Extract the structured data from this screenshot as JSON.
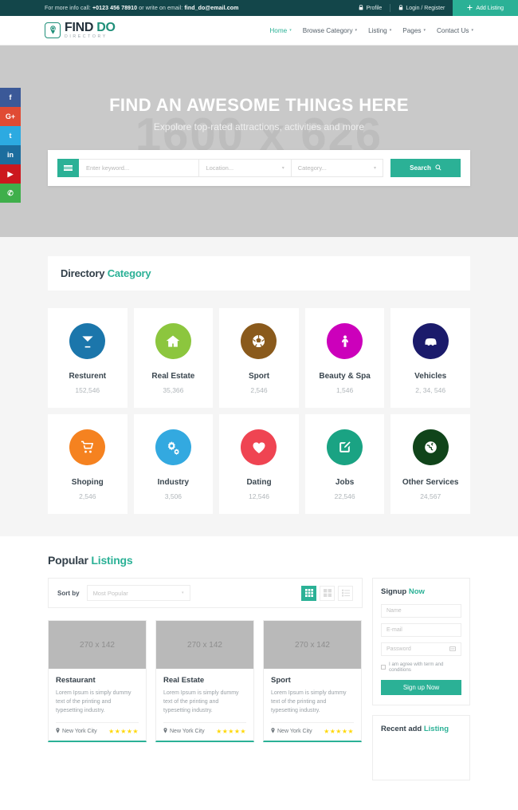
{
  "topbar": {
    "info_prefix": "For more info call:",
    "phone": "+0123 456 78910",
    "info_middle": "or write on email:",
    "email": "find_do@email.com",
    "profile_label": "Profile",
    "login_label": "Login / Register",
    "add_listing_label": "Add Listing",
    "bg_color": "#13464a",
    "accent_color": "#2bb196"
  },
  "nav": {
    "logo_main": "FIND ",
    "logo_accent": "DO",
    "logo_sub": "DIRECTORY",
    "items": [
      {
        "label": "Home",
        "active": true
      },
      {
        "label": "Browse Category",
        "active": false
      },
      {
        "label": "Listing",
        "active": false
      },
      {
        "label": "Pages",
        "active": false
      },
      {
        "label": "Contact Us",
        "active": false
      }
    ]
  },
  "social": [
    {
      "name": "facebook",
      "glyph": "f"
    },
    {
      "name": "google-plus",
      "glyph": "G+"
    },
    {
      "name": "twitter",
      "glyph": "t"
    },
    {
      "name": "linkedin",
      "glyph": "in"
    },
    {
      "name": "youtube",
      "glyph": "▶"
    },
    {
      "name": "whatsapp",
      "glyph": "✆"
    }
  ],
  "hero": {
    "watermark": "1600 x 626",
    "title": "FIND AN AWESOME THINGS HERE",
    "subtitle": "Expolore top-rated attractions, activities and more",
    "search": {
      "keyword_placeholder": "Enter keyword...",
      "location_placeholder": "Location...",
      "category_placeholder": "Category...",
      "button_label": "Search"
    }
  },
  "category_section": {
    "title_main": "Directory ",
    "title_accent": "Category",
    "items": [
      {
        "name": "Resturent",
        "count": "152,546",
        "color": "#1b76ab",
        "icon": "cocktail-icon"
      },
      {
        "name": "Real Estate",
        "count": "35,366",
        "color": "#8cc63e",
        "icon": "home-icon"
      },
      {
        "name": "Sport",
        "count": "2,546",
        "color": "#8a5a1c",
        "icon": "soccer-ball-icon"
      },
      {
        "name": "Beauty & Spa",
        "count": "1,546",
        "color": "#cc00bb",
        "icon": "person-icon"
      },
      {
        "name": "Vehicles",
        "count": "2, 34, 546",
        "color": "#1b1b6b",
        "icon": "car-icon"
      },
      {
        "name": "Shoping",
        "count": "2,546",
        "color": "#f58220",
        "icon": "shopping-cart-icon"
      },
      {
        "name": "Industry",
        "count": "3,506",
        "color": "#33a9e0",
        "icon": "gears-icon"
      },
      {
        "name": "Dating",
        "count": "12,546",
        "color": "#ef4452",
        "icon": "heart-icon"
      },
      {
        "name": "Jobs",
        "count": "22,546",
        "color": "#1aa383",
        "icon": "edit-icon"
      },
      {
        "name": "Other Services",
        "count": "24,567",
        "color": "#10441a",
        "icon": "globe-icon"
      }
    ]
  },
  "listings_section": {
    "title_main": "Popular ",
    "title_accent": "Listings",
    "sort_label": "Sort by",
    "sort_value": "Most Popular",
    "view_modes": [
      {
        "name": "grid-view",
        "active": true
      },
      {
        "name": "large-grid-view",
        "active": false
      },
      {
        "name": "list-view",
        "active": false
      }
    ],
    "cards": [
      {
        "image_label": "270 x 142",
        "title": "Restaurant",
        "desc": "Lorem Ipsum is simply dummy text of the printing and typesetting industry.",
        "location": "New York City",
        "stars": "★★★★★"
      },
      {
        "image_label": "270 x 142",
        "title": "Real Estate",
        "desc": "Lorem Ipsum is simply dummy text of the printing and typesetting industry.",
        "location": "New York City",
        "stars": "★★★★★"
      },
      {
        "image_label": "270 x 142",
        "title": "Sport",
        "desc": "Lorem Ipsum is simply dummy text of the printing and typesetting industry.",
        "location": "New York City",
        "stars": "★★★★★"
      }
    ]
  },
  "sidebar": {
    "signup": {
      "title_main": "Signup ",
      "title_accent": "Now",
      "name_placeholder": "Name",
      "email_placeholder": "E-mail",
      "password_placeholder": "Password",
      "terms_label": "I am agree with term and conditions",
      "button_label": "Sign up Now"
    },
    "recent": {
      "title_main": "Recent add ",
      "title_accent": "Listing"
    }
  }
}
